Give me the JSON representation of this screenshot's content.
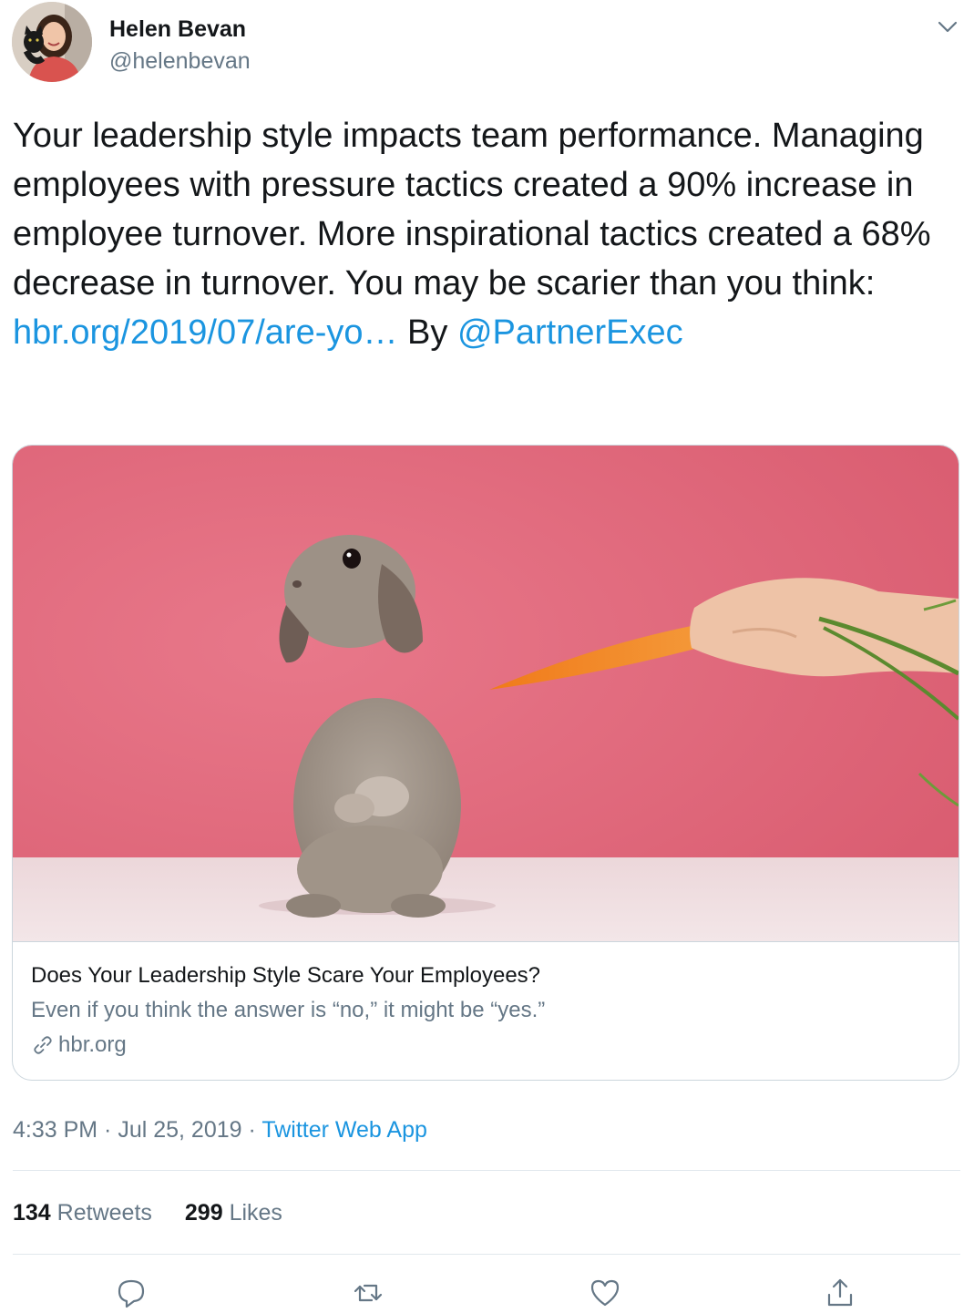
{
  "author": {
    "name": "Helen Bevan",
    "handle": "@helenbevan"
  },
  "tweet": {
    "text_before_link": "Your leadership style impacts team performance. Managing employees with pressure tactics created a 90% increase in employee turnover. More inspirational tactics created a 68% decrease in turnover. You may be scarier than you think: ",
    "link_text": "hbr.org/2019/07/are-yo…",
    "text_after_link": " By ",
    "mention": "@PartnerExec"
  },
  "card": {
    "title": "Does Your Leadership Style Scare Your Employees?",
    "description": "Even if you think the answer is “no,” it might be “yes.”",
    "domain": "hbr.org"
  },
  "meta": {
    "time": "4:33 PM",
    "separator1": " · ",
    "date": "Jul 25, 2019",
    "separator2": " · ",
    "source": "Twitter Web App"
  },
  "stats": {
    "retweets_count": "134",
    "retweets_label": "Retweets",
    "likes_count": "299",
    "likes_label": "Likes"
  },
  "icons": {
    "caret": "chevron-down-icon",
    "reply": "reply-icon",
    "retweet": "retweet-icon",
    "like": "heart-icon",
    "share": "share-icon",
    "link": "link-icon"
  },
  "colors": {
    "link": "#1b95e0",
    "secondary_text": "#657786",
    "primary_text": "#14171a",
    "border": "#ccd6dd",
    "divider": "#e1e8ed",
    "card_background": "#e0697c"
  }
}
